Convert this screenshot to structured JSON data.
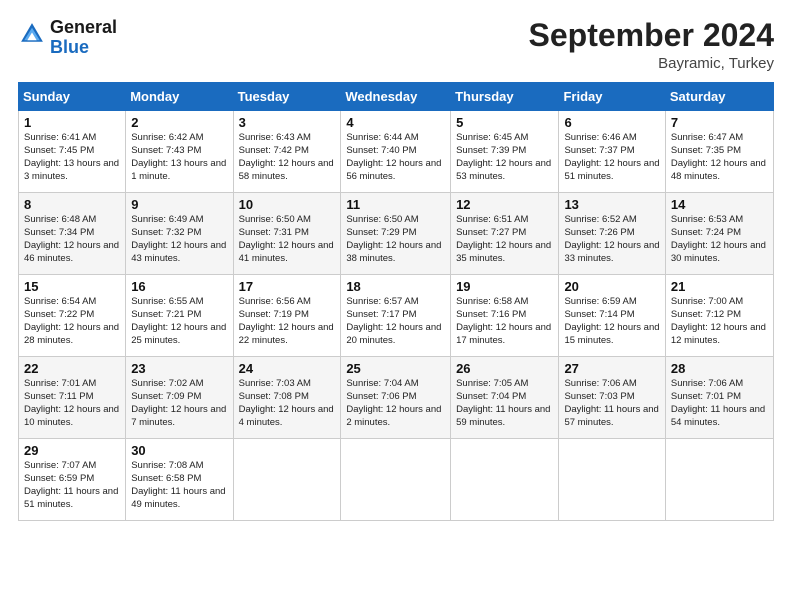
{
  "header": {
    "logo_line1": "General",
    "logo_line2": "Blue",
    "month": "September 2024",
    "location": "Bayramic, Turkey"
  },
  "weekdays": [
    "Sunday",
    "Monday",
    "Tuesday",
    "Wednesday",
    "Thursday",
    "Friday",
    "Saturday"
  ],
  "weeks": [
    [
      {
        "day": "1",
        "sunrise": "6:41 AM",
        "sunset": "7:45 PM",
        "daylight": "13 hours and 3 minutes."
      },
      {
        "day": "2",
        "sunrise": "6:42 AM",
        "sunset": "7:43 PM",
        "daylight": "13 hours and 1 minute."
      },
      {
        "day": "3",
        "sunrise": "6:43 AM",
        "sunset": "7:42 PM",
        "daylight": "12 hours and 58 minutes."
      },
      {
        "day": "4",
        "sunrise": "6:44 AM",
        "sunset": "7:40 PM",
        "daylight": "12 hours and 56 minutes."
      },
      {
        "day": "5",
        "sunrise": "6:45 AM",
        "sunset": "7:39 PM",
        "daylight": "12 hours and 53 minutes."
      },
      {
        "day": "6",
        "sunrise": "6:46 AM",
        "sunset": "7:37 PM",
        "daylight": "12 hours and 51 minutes."
      },
      {
        "day": "7",
        "sunrise": "6:47 AM",
        "sunset": "7:35 PM",
        "daylight": "12 hours and 48 minutes."
      }
    ],
    [
      {
        "day": "8",
        "sunrise": "6:48 AM",
        "sunset": "7:34 PM",
        "daylight": "12 hours and 46 minutes."
      },
      {
        "day": "9",
        "sunrise": "6:49 AM",
        "sunset": "7:32 PM",
        "daylight": "12 hours and 43 minutes."
      },
      {
        "day": "10",
        "sunrise": "6:50 AM",
        "sunset": "7:31 PM",
        "daylight": "12 hours and 41 minutes."
      },
      {
        "day": "11",
        "sunrise": "6:50 AM",
        "sunset": "7:29 PM",
        "daylight": "12 hours and 38 minutes."
      },
      {
        "day": "12",
        "sunrise": "6:51 AM",
        "sunset": "7:27 PM",
        "daylight": "12 hours and 35 minutes."
      },
      {
        "day": "13",
        "sunrise": "6:52 AM",
        "sunset": "7:26 PM",
        "daylight": "12 hours and 33 minutes."
      },
      {
        "day": "14",
        "sunrise": "6:53 AM",
        "sunset": "7:24 PM",
        "daylight": "12 hours and 30 minutes."
      }
    ],
    [
      {
        "day": "15",
        "sunrise": "6:54 AM",
        "sunset": "7:22 PM",
        "daylight": "12 hours and 28 minutes."
      },
      {
        "day": "16",
        "sunrise": "6:55 AM",
        "sunset": "7:21 PM",
        "daylight": "12 hours and 25 minutes."
      },
      {
        "day": "17",
        "sunrise": "6:56 AM",
        "sunset": "7:19 PM",
        "daylight": "12 hours and 22 minutes."
      },
      {
        "day": "18",
        "sunrise": "6:57 AM",
        "sunset": "7:17 PM",
        "daylight": "12 hours and 20 minutes."
      },
      {
        "day": "19",
        "sunrise": "6:58 AM",
        "sunset": "7:16 PM",
        "daylight": "12 hours and 17 minutes."
      },
      {
        "day": "20",
        "sunrise": "6:59 AM",
        "sunset": "7:14 PM",
        "daylight": "12 hours and 15 minutes."
      },
      {
        "day": "21",
        "sunrise": "7:00 AM",
        "sunset": "7:12 PM",
        "daylight": "12 hours and 12 minutes."
      }
    ],
    [
      {
        "day": "22",
        "sunrise": "7:01 AM",
        "sunset": "7:11 PM",
        "daylight": "12 hours and 10 minutes."
      },
      {
        "day": "23",
        "sunrise": "7:02 AM",
        "sunset": "7:09 PM",
        "daylight": "12 hours and 7 minutes."
      },
      {
        "day": "24",
        "sunrise": "7:03 AM",
        "sunset": "7:08 PM",
        "daylight": "12 hours and 4 minutes."
      },
      {
        "day": "25",
        "sunrise": "7:04 AM",
        "sunset": "7:06 PM",
        "daylight": "12 hours and 2 minutes."
      },
      {
        "day": "26",
        "sunrise": "7:05 AM",
        "sunset": "7:04 PM",
        "daylight": "11 hours and 59 minutes."
      },
      {
        "day": "27",
        "sunrise": "7:06 AM",
        "sunset": "7:03 PM",
        "daylight": "11 hours and 57 minutes."
      },
      {
        "day": "28",
        "sunrise": "7:06 AM",
        "sunset": "7:01 PM",
        "daylight": "11 hours and 54 minutes."
      }
    ],
    [
      {
        "day": "29",
        "sunrise": "7:07 AM",
        "sunset": "6:59 PM",
        "daylight": "11 hours and 51 minutes."
      },
      {
        "day": "30",
        "sunrise": "7:08 AM",
        "sunset": "6:58 PM",
        "daylight": "11 hours and 49 minutes."
      },
      null,
      null,
      null,
      null,
      null
    ]
  ],
  "labels": {
    "sunrise": "Sunrise:",
    "sunset": "Sunset:",
    "daylight": "Daylight:"
  }
}
